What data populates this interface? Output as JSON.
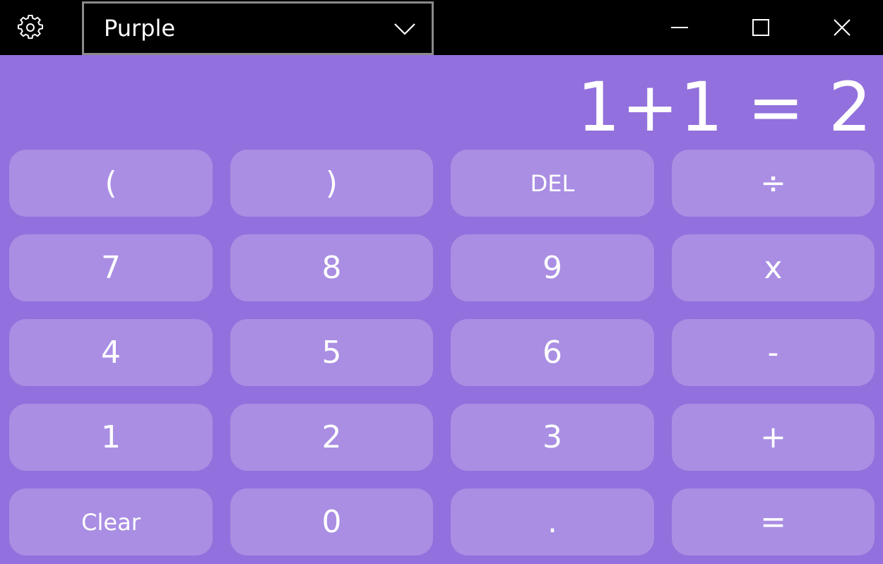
{
  "window": {
    "background": "#9270dd",
    "titlebar_color": "#000000"
  },
  "titlebar": {
    "settings_icon": "gear-icon",
    "theme_selected": "Purple",
    "dropdown_icon": "chevron-down-icon",
    "minimize_icon": "minimize-icon",
    "maximize_icon": "maximize-icon",
    "close_icon": "close-icon"
  },
  "display": {
    "expression": "1+1 = 2"
  },
  "keypad": {
    "key_color": "#a98ee3",
    "keys": [
      {
        "label": "(",
        "name": "open-paren-key"
      },
      {
        "label": ")",
        "name": "close-paren-key"
      },
      {
        "label": "DEL",
        "name": "delete-key"
      },
      {
        "label": "÷",
        "name": "divide-key"
      },
      {
        "label": "7",
        "name": "digit-7-key"
      },
      {
        "label": "8",
        "name": "digit-8-key"
      },
      {
        "label": "9",
        "name": "digit-9-key"
      },
      {
        "label": "x",
        "name": "multiply-key"
      },
      {
        "label": "4",
        "name": "digit-4-key"
      },
      {
        "label": "5",
        "name": "digit-5-key"
      },
      {
        "label": "6",
        "name": "digit-6-key"
      },
      {
        "label": "-",
        "name": "subtract-key"
      },
      {
        "label": "1",
        "name": "digit-1-key"
      },
      {
        "label": "2",
        "name": "digit-2-key"
      },
      {
        "label": "3",
        "name": "digit-3-key"
      },
      {
        "label": "+",
        "name": "add-key"
      },
      {
        "label": "Clear",
        "name": "clear-key"
      },
      {
        "label": "0",
        "name": "digit-0-key"
      },
      {
        "label": ".",
        "name": "decimal-point-key"
      },
      {
        "label": "=",
        "name": "equals-key"
      }
    ]
  }
}
